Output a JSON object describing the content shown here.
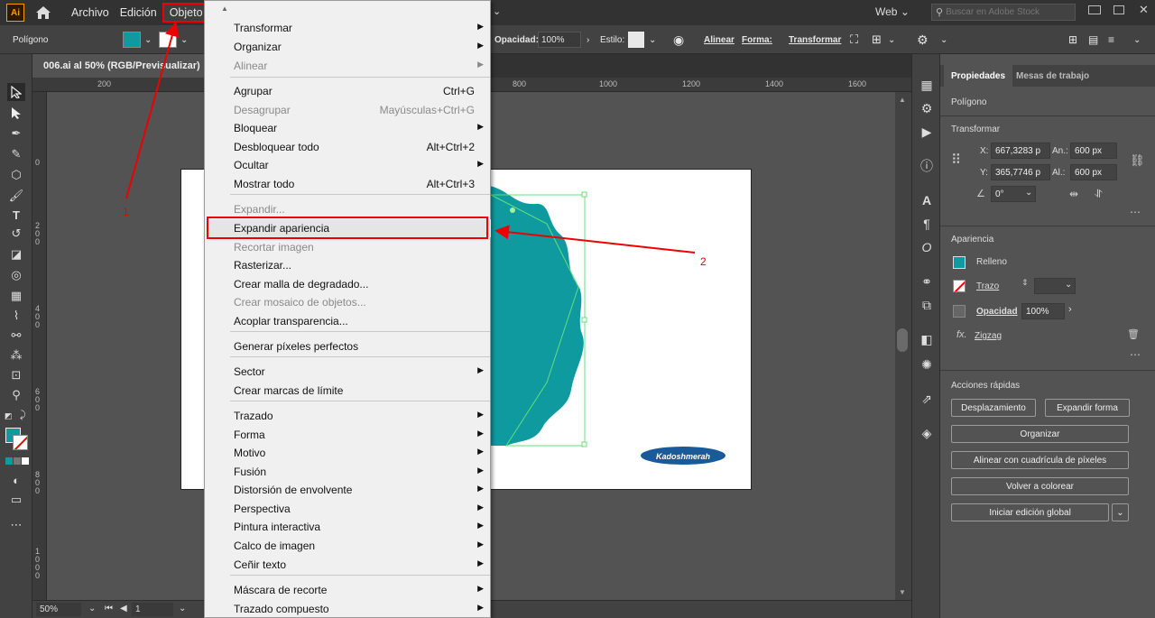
{
  "app": {
    "logo": "Ai"
  },
  "menubar": {
    "items": [
      "Archivo",
      "Edición",
      "Objeto"
    ],
    "workspace": "Web",
    "search_placeholder": "Buscar en Adobe Stock"
  },
  "controlbar": {
    "selection_type": "Polígono",
    "opacity_label": "Opacidad:",
    "opacity_value": "100%",
    "style_label": "Estilo:",
    "align_label": "Alinear",
    "shape_label": "Forma:",
    "transform_label": "Transformar"
  },
  "document": {
    "tab_title": "006.ai al 50% (RGB/Previsualizar)",
    "zoom": "50%",
    "artboard_number": "1",
    "ruler_top": [
      "200",
      "800",
      "1000",
      "1200",
      "1400",
      "1600"
    ],
    "ruler_left": [
      "0",
      "200",
      "400",
      "600",
      "800",
      "1000"
    ],
    "logo_text": "Kadoshmerah"
  },
  "menu": {
    "items": [
      {
        "label": "Transformar",
        "submenu": true
      },
      {
        "label": "Organizar",
        "submenu": true
      },
      {
        "label": "Alinear",
        "submenu": true,
        "disabled": true
      },
      {
        "label": "Agrupar",
        "shortcut": "Ctrl+G"
      },
      {
        "label": "Desagrupar",
        "shortcut": "Mayúsculas+Ctrl+G",
        "disabled": true
      },
      {
        "label": "Bloquear",
        "submenu": true
      },
      {
        "label": "Desbloquear todo",
        "shortcut": "Alt+Ctrl+2"
      },
      {
        "label": "Ocultar",
        "submenu": true
      },
      {
        "label": "Mostrar todo",
        "shortcut": "Alt+Ctrl+3"
      },
      {
        "label": "Expandir...",
        "disabled": true
      },
      {
        "label": "Expandir apariencia",
        "highlighted": true
      },
      {
        "label": "Recortar imagen",
        "disabled": true
      },
      {
        "label": "Rasterizar..."
      },
      {
        "label": "Crear malla de degradado..."
      },
      {
        "label": "Crear mosaico de objetos...",
        "disabled": true
      },
      {
        "label": "Acoplar transparencia..."
      },
      {
        "label": "Generar píxeles perfectos"
      },
      {
        "label": "Sector",
        "submenu": true
      },
      {
        "label": "Crear marcas de límite"
      },
      {
        "label": "Trazado",
        "submenu": true
      },
      {
        "label": "Forma",
        "submenu": true
      },
      {
        "label": "Motivo",
        "submenu": true
      },
      {
        "label": "Fusión",
        "submenu": true
      },
      {
        "label": "Distorsión de envolvente",
        "submenu": true
      },
      {
        "label": "Perspectiva",
        "submenu": true
      },
      {
        "label": "Pintura interactiva",
        "submenu": true
      },
      {
        "label": "Calco de imagen",
        "submenu": true
      },
      {
        "label": "Ceñir texto",
        "submenu": true
      },
      {
        "label": "Máscara de recorte",
        "submenu": true
      },
      {
        "label": "Trazado compuesto",
        "submenu": true
      }
    ]
  },
  "properties": {
    "tab_active": "Propiedades",
    "tab_other": "Mesas de trabajo",
    "object_type": "Polígono",
    "transform_title": "Transformar",
    "x_label": "X:",
    "x_value": "667,3283 p",
    "y_label": "Y:",
    "y_value": "365,7746 p",
    "w_label": "An.:",
    "w_value": "600 px",
    "h_label": "Al.:",
    "h_value": "600 px",
    "angle_value": "0°",
    "appearance_title": "Apariencia",
    "fill_label": "Relleno",
    "stroke_label": "Trazo",
    "opacity_label": "Opacidad",
    "opacity_value": "100%",
    "effect_label": "Zigzag",
    "quick_actions_title": "Acciones rápidas",
    "btn_offset": "Desplazamiento",
    "btn_expand": "Expandir forma",
    "btn_arrange": "Organizar",
    "btn_pixel_grid": "Alinear con cuadrícula de píxeles",
    "btn_recolor": "Volver a colorear",
    "btn_global_edit": "Iniciar edición global"
  },
  "annotations": {
    "label_1": "1",
    "label_2": "2"
  },
  "colors": {
    "fill": "#0f9aa0",
    "accent_annotation": "#e00000"
  }
}
